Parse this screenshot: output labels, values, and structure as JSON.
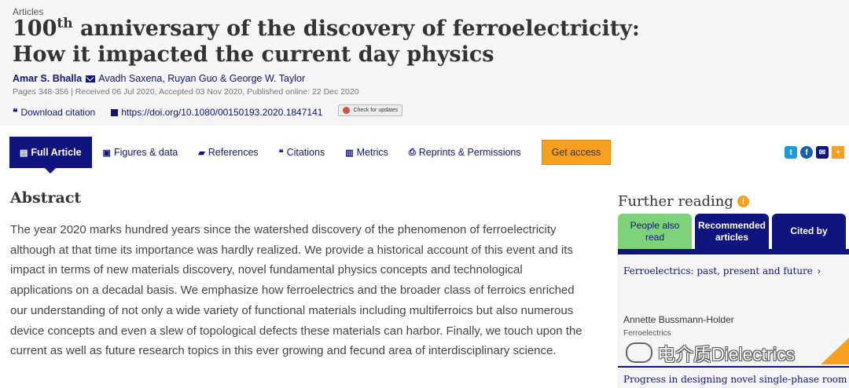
{
  "article": {
    "kicker": "Articles",
    "title_num": "100",
    "title_sup": "th",
    "title_rest": " anniversary of the discovery of ferroelectricity: How it impacted the current day physics",
    "author_first": "Amar S. Bhalla",
    "authors_rest": "Avadh Saxena, Ruyan Guo & George W. Taylor",
    "meta": "Pages 348-356 | Received 06 Jul 2020, Accepted 03 Nov 2020, Published online: 22 Dec 2020",
    "download_citation": "Download citation",
    "doi": "https://doi.org/10.1080/00150193.2020.1847141",
    "check_updates": "Check for updates"
  },
  "tabs": {
    "full_article": "Full Article",
    "figures": "Figures & data",
    "references": "References",
    "citations": "Citations",
    "metrics": "Metrics",
    "reprints": "Reprints & Permissions",
    "get_access": "Get access"
  },
  "share": {
    "twitter": "t",
    "facebook": "f",
    "email": "✉",
    "more": "+"
  },
  "abstract": {
    "heading": "Abstract",
    "text": "The year 2020 marks hundred years since the watershed discovery of the phenomenon of ferroelectricity although at that time its importance was hardly realized. We provide a historical account of this event and its impact in terms of new materials discovery, novel fundamental physics concepts and technological applications on a decadal basis. We emphasize how ferroelectrics and the broader class of ferroics enriched our understanding of not only a wide variety of functional materials including multiferroics but also numerous device concepts and even a slew of topological defects these materials can harbor. Finally, we touch upon the current as well as future research topics in this ever growing and fecund area of interdisciplinary science."
  },
  "further": {
    "heading": "Further reading",
    "info": "i",
    "tabs": [
      "People also read",
      "Recommended articles",
      "Cited by"
    ],
    "item1_title": "Ferroelectrics: past, present and future",
    "item1_author": "Annette Bussmann-Holder",
    "item1_journal": "Ferroelectrics",
    "item2_title": "Progress in designing novel single-phase room"
  },
  "watermark": "电介质Dielectrics"
}
